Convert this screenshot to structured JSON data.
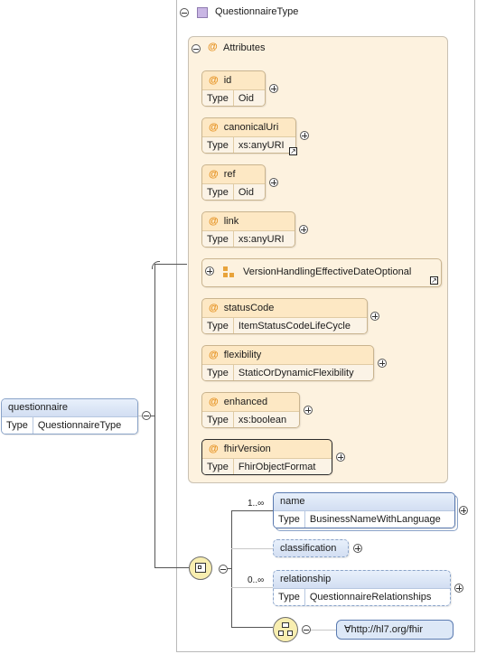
{
  "root": {
    "name": "questionnaire",
    "type_key": "Type",
    "type_value": "QuestionnaireType"
  },
  "complex_type": {
    "name": "QuestionnaireType"
  },
  "attributes_group": {
    "label": "Attributes",
    "at_symbol": "@"
  },
  "attributes": [
    {
      "name": "id",
      "type_key": "Type",
      "type_value": "Oid"
    },
    {
      "name": "canonicalUri",
      "type_key": "Type",
      "type_value": "xs:anyURI"
    },
    {
      "name": "ref",
      "type_key": "Type",
      "type_value": "Oid"
    },
    {
      "name": "link",
      "type_key": "Type",
      "type_value": "xs:anyURI"
    },
    {
      "name": "statusCode",
      "type_key": "Type",
      "type_value": "ItemStatusCodeLifeCycle"
    },
    {
      "name": "flexibility",
      "type_key": "Type",
      "type_value": "StaticOrDynamicFlexibility"
    },
    {
      "name": "enhanced",
      "type_key": "Type",
      "type_value": "xs:boolean"
    },
    {
      "name": "fhirVersion",
      "type_key": "Type",
      "type_value": "FhirObjectFormat"
    }
  ],
  "attribute_group_ref": {
    "name": "VersionHandlingEffectiveDateOptional"
  },
  "sequence": {
    "elements": [
      {
        "name": "name",
        "multiplicity": "1..∞",
        "type_key": "Type",
        "type_value": "BusinessNameWithLanguage"
      },
      {
        "name": "classification"
      },
      {
        "name": "relationship",
        "multiplicity": "0..∞",
        "type_key": "Type",
        "type_value": "QuestionnaireRelationships"
      }
    ],
    "any": {
      "label": "∀http://hl7.org/fhir"
    }
  },
  "colors": {
    "attribute_fill": "#fde8c4",
    "element_fill": "#dde8f7",
    "at_symbol": "#e58f1c",
    "compositor_fill": "#f8eeb0"
  }
}
